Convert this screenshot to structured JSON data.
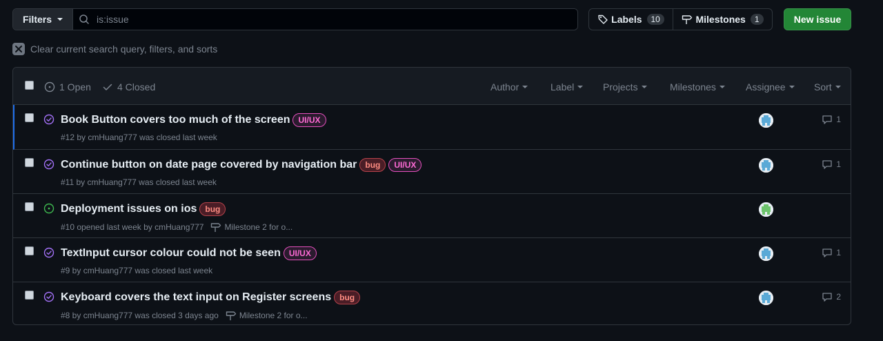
{
  "toolbar": {
    "filters_label": "Filters",
    "search_value": "is:issue",
    "labels_label": "Labels",
    "labels_count": "10",
    "milestones_label": "Milestones",
    "milestones_count": "1",
    "new_issue_label": "New issue",
    "clear_text": "Clear current search query, filters, and sorts"
  },
  "header": {
    "open_label": "1 Open",
    "closed_label": "4 Closed",
    "menus": [
      "Author",
      "Label",
      "Projects",
      "Milestones",
      "Assignee",
      "Sort"
    ]
  },
  "issues": [
    {
      "title": "Book Button covers too much of the screen",
      "labels": [
        "UI/UX"
      ],
      "meta": "#12 by cmHuang777 was closed last week",
      "milestone": "",
      "comments": "1",
      "state": "closed"
    },
    {
      "title": "Continue button on date page covered by navigation bar",
      "labels": [
        "bug",
        "UI/UX"
      ],
      "meta": "#11 by cmHuang777 was closed last week",
      "milestone": "",
      "comments": "1",
      "state": "closed"
    },
    {
      "title": "Deployment issues on ios",
      "labels": [
        "bug"
      ],
      "meta": "#10 opened last week by cmHuang777",
      "milestone": "Milestone 2 for o...",
      "comments": "",
      "state": "open"
    },
    {
      "title": "TextInput cursor colour could not be seen",
      "labels": [
        "UI/UX"
      ],
      "meta": "#9 by cmHuang777 was closed last week",
      "milestone": "",
      "comments": "1",
      "state": "closed"
    },
    {
      "title": "Keyboard covers the text input on Register screens",
      "labels": [
        "bug"
      ],
      "meta": "#8 by cmHuang777 was closed 3 days ago",
      "milestone": "Milestone 2 for o...",
      "comments": "2",
      "state": "closed"
    }
  ],
  "colors": {
    "background": "#0d1117",
    "new_issue": "#238636",
    "closed_icon": "#a371f7",
    "open_icon": "#3fb950",
    "uiux_label": "#ff6bd6",
    "bug_label": "#ff8c82"
  }
}
